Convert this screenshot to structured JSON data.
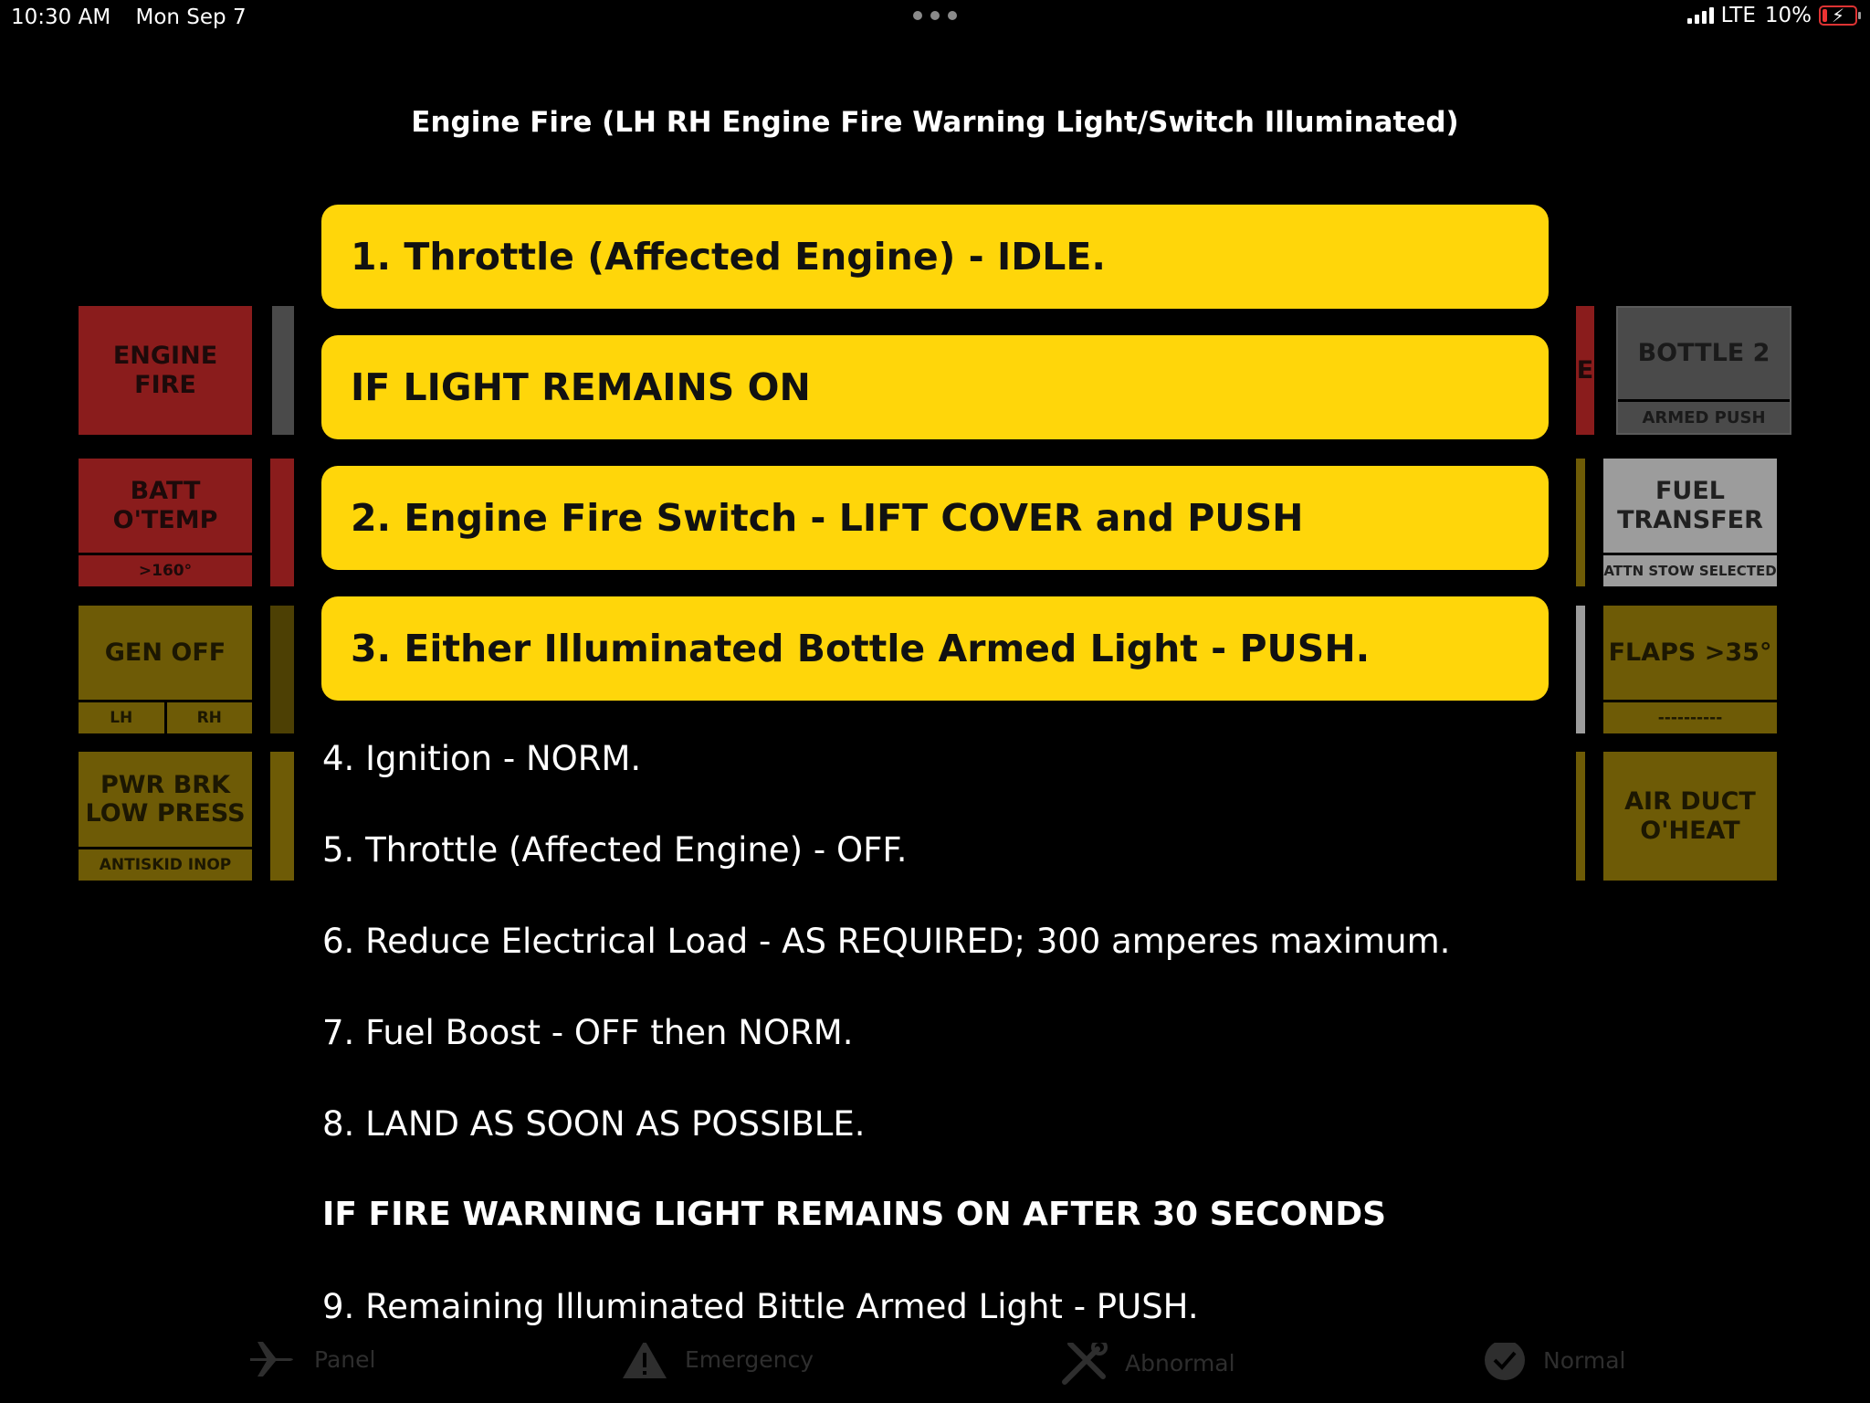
{
  "status_bar": {
    "time": "10:30 AM",
    "date": "Mon Sep 7",
    "network": "LTE",
    "battery": "10%"
  },
  "panels": {
    "engine_fire": {
      "main": "ENGINE FIRE"
    },
    "bottle_2": {
      "main": "BOTTLE 2",
      "sub": "ARMED PUSH"
    },
    "batt_otemp": {
      "main": "BATT\nO'TEMP",
      "sub": ">160°"
    },
    "fuel_transfer": {
      "main": "FUEL\nTRANSFER",
      "sub": "ATTN STOW SELECTED"
    },
    "gen_off": {
      "main": "GEN OFF",
      "sub_left": "LH",
      "sub_right": "RH"
    },
    "flaps": {
      "main": "FLAPS >35°",
      "sub": "----------"
    },
    "pwr_brk": {
      "main": "PWR BRK\nLOW PRESS",
      "sub": "ANTISKID INOP"
    },
    "air_duct": {
      "main": "AIR DUCT\nO'HEAT"
    },
    "partial_right_e": "E"
  },
  "modal": {
    "title": "Engine Fire (LH RH Engine Fire Warning Light/Switch Illuminated)",
    "highlight_steps": [
      "1. Throttle (Affected Engine) - IDLE.",
      "IF LIGHT REMAINS ON",
      "2. Engine Fire Switch - LIFT COVER and PUSH",
      "3. Either Illuminated Bottle Armed Light - PUSH."
    ],
    "steps": [
      "4. Ignition - NORM.",
      "5. Throttle (Affected Engine) - OFF.",
      "6. Reduce Electrical Load - AS REQUIRED; 300 amperes maximum.",
      "7. Fuel Boost - OFF then NORM.",
      "8. LAND AS SOON AS POSSIBLE.",
      "IF FIRE WARNING LIGHT REMAINS ON AFTER 30 SECONDS",
      "9. Remaining Illuminated Bittle Armed Light - PUSH."
    ]
  },
  "tabs": {
    "panel": "Panel",
    "emergency": "Emergency",
    "abnormal": "Abnormal",
    "normal": "Normal"
  }
}
